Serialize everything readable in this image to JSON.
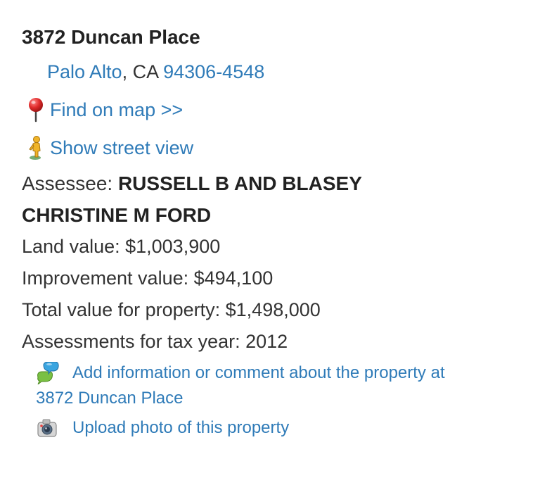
{
  "property": {
    "title": "3872 Duncan Place",
    "address": {
      "city": "Palo Alto",
      "separator": ", CA ",
      "zip": "94306-4548"
    },
    "find_on_map": {
      "label": "Find on map >>",
      "icon": "map-pin-icon"
    },
    "street_view": {
      "label": "Show street view",
      "icon": "pegman-icon"
    },
    "assessee": {
      "prefix": "Assessee: ",
      "name": "RUSSELL B AND BLASEY CHRISTINE M FORD"
    },
    "land_value": "Land value: $1,003,900",
    "improvement_value": "Improvement value: $494,100",
    "total_value": "Total value for property: $1,498,000",
    "tax_year": "Assessments for tax year: 2012",
    "comment_link": {
      "line1": "Add information or comment about the property at",
      "line2": "3872 Duncan Place",
      "icon": "comment-bubbles-icon"
    },
    "upload_link": {
      "label": "Upload photo of this property",
      "icon": "camera-icon"
    }
  },
  "colors": {
    "link": "#2f7bb8",
    "text": "#333333",
    "heading": "#222222",
    "pin_red": "#d42a2a",
    "bubble_blue": "#3aa5e0",
    "bubble_green": "#7ac043"
  }
}
